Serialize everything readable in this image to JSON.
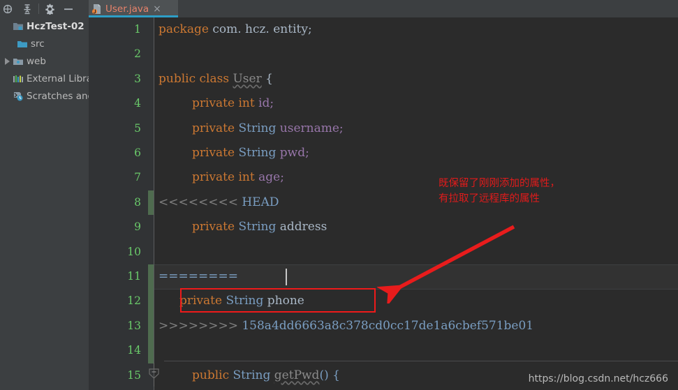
{
  "toolbar": {
    "icons": [
      {
        "name": "locate-icon",
        "title": "Select Opened File"
      },
      {
        "name": "collapse-all-icon",
        "title": "Collapse All"
      },
      {
        "name": "settings-gear-icon",
        "title": "Settings"
      },
      {
        "name": "minimize-icon",
        "title": "Hide"
      }
    ]
  },
  "sidebar": {
    "items": [
      {
        "label": "HczTest-02 ",
        "icon": "project-folder-icon",
        "level": 0,
        "expanded": true,
        "root": true
      },
      {
        "label": "src",
        "icon": "source-folder-icon",
        "level": 1,
        "expanded": false,
        "root": false
      },
      {
        "label": "web",
        "icon": "web-folder-icon",
        "level": 0,
        "expanded": false,
        "root": false
      },
      {
        "label": "External Libra",
        "icon": "libraries-icon",
        "level": 0,
        "expanded": false,
        "root": false
      },
      {
        "label": "Scratches and",
        "icon": "scratches-icon",
        "level": 0,
        "expanded": false,
        "root": false
      }
    ]
  },
  "tab": {
    "filename": "User.java",
    "close_label": "×",
    "icon": "java-class-icon",
    "active_underline_color": "#2d9ec7",
    "text_color": "#e8836b"
  },
  "editor": {
    "lines": [
      {
        "no": "1",
        "changed": false,
        "highlight": false
      },
      {
        "no": "2",
        "changed": false,
        "highlight": false
      },
      {
        "no": "3",
        "changed": false,
        "highlight": false
      },
      {
        "no": "4",
        "changed": false,
        "highlight": false
      },
      {
        "no": "5",
        "changed": false,
        "highlight": false
      },
      {
        "no": "6",
        "changed": false,
        "highlight": false
      },
      {
        "no": "7",
        "changed": false,
        "highlight": false
      },
      {
        "no": "8",
        "changed": true,
        "highlight": false
      },
      {
        "no": "9",
        "changed": false,
        "highlight": false
      },
      {
        "no": "10",
        "changed": false,
        "highlight": false
      },
      {
        "no": "11",
        "changed": true,
        "highlight": true
      },
      {
        "no": "12",
        "changed": true,
        "highlight": false
      },
      {
        "no": "13",
        "changed": true,
        "highlight": false
      },
      {
        "no": "14",
        "changed": false,
        "highlight": false
      },
      {
        "no": "15",
        "changed": false,
        "highlight": false
      }
    ],
    "code": {
      "l1_kw": "package",
      "l1_pkg": " com. hcz. entity;",
      "l3_kw": "public class",
      "l3_cls": "User",
      "l3_brace": " {",
      "l4_kw": "private",
      "l4_ty": "int",
      "l4_name": "id;",
      "l5_kw": "private",
      "l5_ty": "String",
      "l5_name": "username;",
      "l6_kw": "private",
      "l6_ty": "String",
      "l6_name": "pwd;",
      "l7_kw": "private",
      "l7_ty": "int",
      "l7_name": "age;",
      "l8_marker": "<<<<<<<<",
      "l8_head": "HEAD",
      "l9_kw": "private",
      "l9_ty": "String",
      "l9_name": "address",
      "l11_marker": "========",
      "l12_kw": "private",
      "l12_ty": "String",
      "l12_name": "phone",
      "l13_marker": ">>>>>>>>",
      "l13_hash": "158a4dd6663a8c378cd0cc17de1a6cbef571be01",
      "l15_kw": "public",
      "l15_ty": "String",
      "l15_method": "getPwd",
      "l15_tail": "() {"
    }
  },
  "annotations": {
    "note_line1": "既保留了刚刚添加的属性，",
    "note_line2": "有拉取了远程库的属性",
    "note_color": "#e11b1b",
    "highlight_box_color": "#ef1a1a",
    "arrow_color": "#e81c1c"
  },
  "watermark": {
    "text": "https://blog.csdn.net/hcz666"
  }
}
